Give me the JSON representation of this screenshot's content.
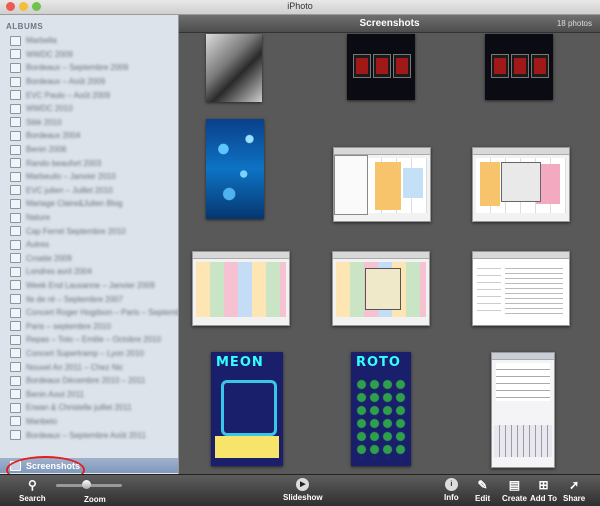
{
  "window": {
    "title": "iPhoto",
    "lights": [
      "#ee5a52",
      "#f2be3c",
      "#6fc34a"
    ]
  },
  "sidebar": {
    "heading": "ALBUMS",
    "albums": [
      "Marbella",
      "WWDC 2009",
      "Bordeaux – Septembre 2009",
      "Bordeaux – Août 2009",
      "EVC Paulo – Août 2009",
      "WWDC 2010",
      "Stilé 2010",
      "Bordeaux 2004",
      "Benin 2006",
      "Rando beaufort 2003",
      "Marbeuilo – Janvier 2010",
      "EVC julien – Juillet 2010",
      "Mariage Claire&Julien Blog",
      "Nature",
      "Cap Ferret Septembre 2010",
      "Autres",
      "Croatie 2009",
      "Londres avril 2004",
      "Week End Lausanne – Janvier 2009",
      "Ile de ré – Septembre 2007",
      "Concert Roger Hogdson – Paris – Septembre 2010",
      "Paris – septembre 2010",
      "Repas – Toto – Emilie – Octobre 2010",
      "Concert Supertramp – Lyon 2010",
      "Nouvel An 2011 – Chez Nic",
      "Bordeaux Décembre 2010 – 2011",
      "Benin Aout 2011",
      "Erwan & Christelle juillet 2011",
      "Manbeto",
      "Bordeaux – Septembre Août 2011"
    ],
    "selected": "Screenshots"
  },
  "main": {
    "title": "Screenshots",
    "count": "18 photos",
    "game1_logo": "MEON",
    "game2_logo": "ROTO"
  },
  "toolbar": {
    "search": "Search",
    "zoom": "Zoom",
    "zoom_level": 0.45,
    "slideshow": "Slideshow",
    "info": "Info",
    "edit": "Edit",
    "create": "Create",
    "add_to": "Add To",
    "share": "Share"
  },
  "colors": {
    "selection_circle": "#e61d1d",
    "sidebar_bg": "#dde3ea",
    "main_bg": "#595959"
  }
}
